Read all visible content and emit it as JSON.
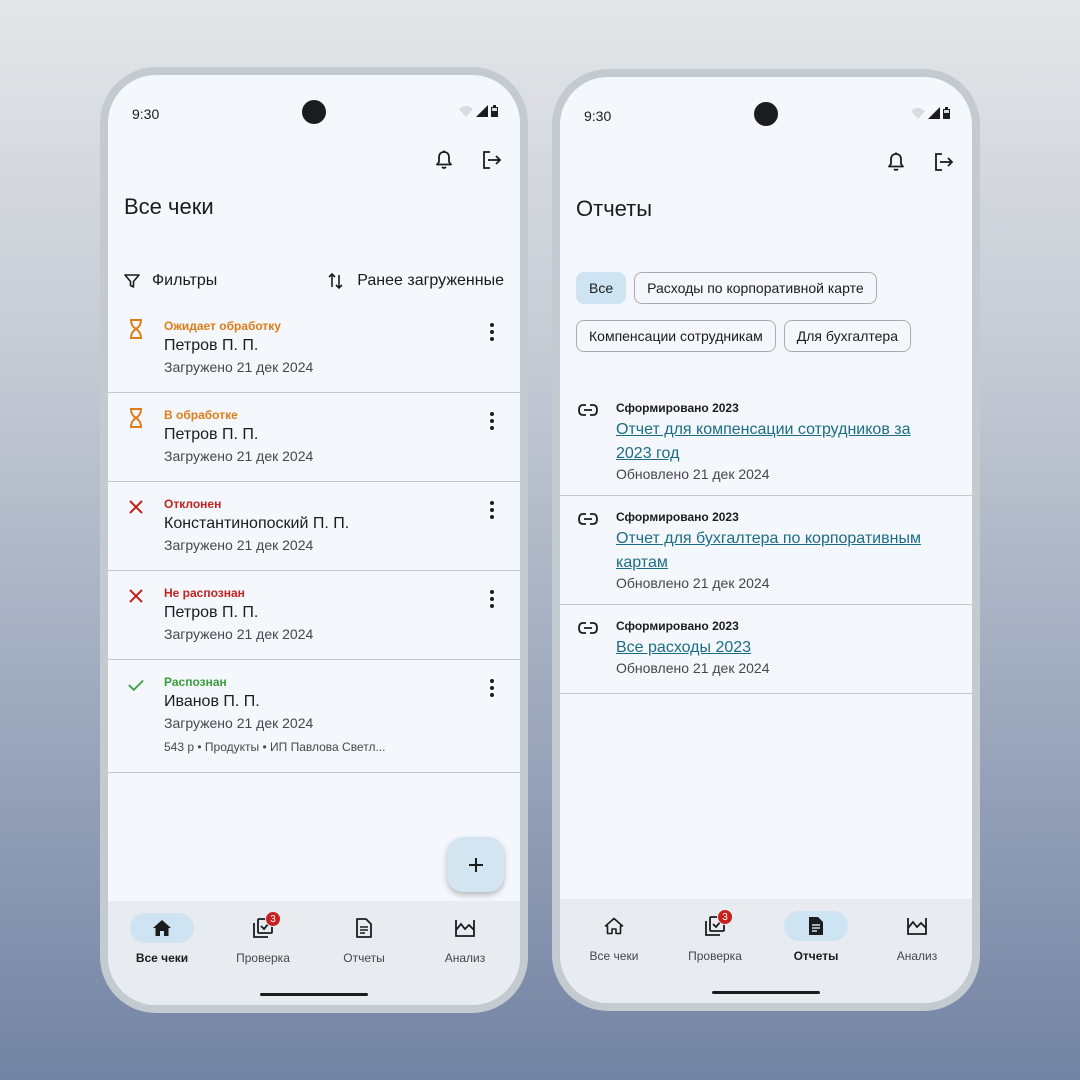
{
  "left": {
    "status_time": "9:30",
    "title": "Все чеки",
    "filters_label": "Фильтры",
    "sort_label": "Ранее загруженные",
    "receipts": [
      {
        "status": "Ожидает обработку",
        "status_color": "#de7d18",
        "icon": "hourglass-icon",
        "name": "Петров П. П.",
        "date": "Загружено 21 дек 2024"
      },
      {
        "status": "В обработке",
        "status_color": "#de7d18",
        "icon": "hourglass-icon",
        "name": "Петров П. П.",
        "date": "Загружено 21 дек 2024"
      },
      {
        "status": "Отклонен",
        "status_color": "#c5221f",
        "icon": "close-icon",
        "name": "Константинопоский П. П.",
        "date": "Загружено 21 дек 2024"
      },
      {
        "status": "Не распознан",
        "status_color": "#c5221f",
        "icon": "close-icon",
        "name": "Петров П. П.",
        "date": "Загружено 21 дек 2024"
      },
      {
        "status": "Распознан",
        "status_color": "#3b9c3e",
        "icon": "check-icon",
        "name": "Иванов П. П.",
        "date": "Загружено 21 дек 2024",
        "meta": "543 р • Продукты • ИП Павлова Светл..."
      }
    ],
    "nav": {
      "active": "Все чеки",
      "items": [
        "Все чеки",
        "Проверка",
        "Отчеты",
        "Анализ"
      ],
      "badge": "3"
    }
  },
  "right": {
    "status_time": "9:30",
    "title": "Отчеты",
    "chips": [
      "Все",
      "Расходы по корпоративной карте",
      "Компенсации сотрудникам",
      "Для бухгалтера"
    ],
    "selected_chip": "Все",
    "reports": [
      {
        "kicker": "Сформировано 2023",
        "title": "Отчет для компенсации сотрудников за 2023 год",
        "updated": "Обновлено 21 дек 2024"
      },
      {
        "kicker": "Сформировано 2023",
        "title": "Отчет для бухгалтера по корпоративным картам",
        "updated": "Обновлено 21 дек 2024"
      },
      {
        "kicker": "Сформировано 2023",
        "title": "Все расходы 2023",
        "updated": "Обновлено 21 дек 2024"
      }
    ],
    "nav": {
      "active": "Отчеты",
      "items": [
        "Все чеки",
        "Проверка",
        "Отчеты",
        "Анализ"
      ],
      "badge": "3"
    }
  },
  "colors": {
    "accent_pill": "#cfe4f2",
    "link": "#1b6d86",
    "badge": "#c5221f"
  }
}
